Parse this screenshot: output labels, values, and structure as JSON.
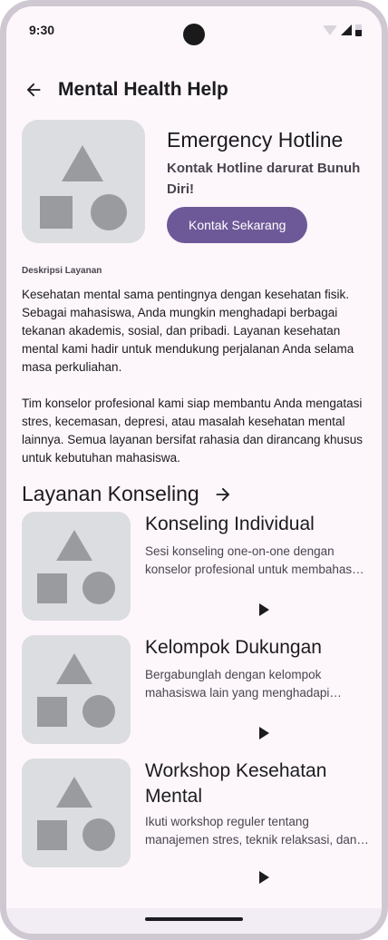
{
  "status_bar": {
    "time": "9:30"
  },
  "app_bar": {
    "title": "Mental Health Help",
    "back_icon": "arrow-back-icon"
  },
  "hero": {
    "title": "Emergency Hotline",
    "subtitle": "Kontak Hotline darurat Bunuh Diri!",
    "button_label": "Kontak Sekarang",
    "accent_color": "#6e5998"
  },
  "description": {
    "label": "Deskripsi Layanan",
    "paragraph_1": "Kesehatan mental sama pentingnya dengan kesehatan fisik. Sebagai mahasiswa, Anda mungkin menghadapi berbagai tekanan akademis, sosial, dan pribadi. Layanan kesehatan mental kami hadir untuk mendukung perjalanan Anda selama masa perkuliahan.",
    "paragraph_2": "Tim konselor profesional kami siap membantu Anda mengatasi stres, kecemasan, depresi, atau masalah kesehatan mental lainnya. Semua layanan bersifat rahasia dan dirancang khusus untuk kebutuhan mahasiswa."
  },
  "section": {
    "title": "Layanan Konseling",
    "arrow_icon": "arrow-forward-icon"
  },
  "services": [
    {
      "title": "Konseling Individual",
      "description": "Sesi konseling one-on-one dengan konselor profesional untuk membahas masalah pribadi Anda."
    },
    {
      "title": "Kelompok Dukungan",
      "description": "Bergabunglah dengan kelompok mahasiswa lain yang menghadapi tantangan serupa."
    },
    {
      "title": "Workshop Kesehatan Mental",
      "description": "Ikuti workshop reguler tentang manajemen stres, teknik relaksasi, dan kesehatan mental."
    }
  ]
}
